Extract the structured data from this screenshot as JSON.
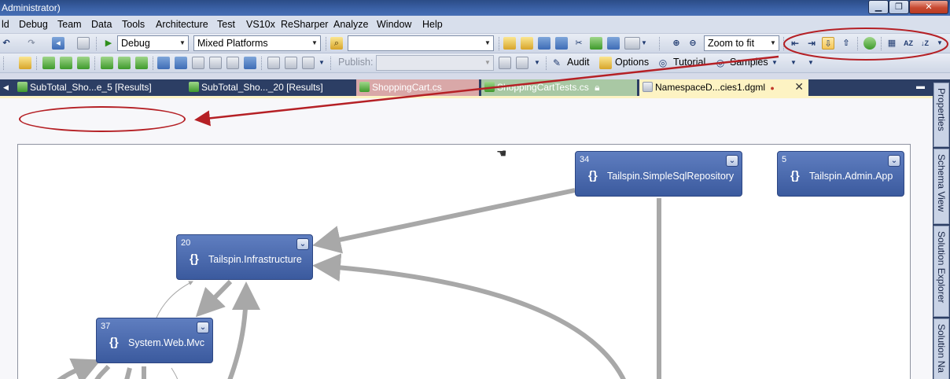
{
  "window": {
    "title_fragment": "Administrator)",
    "minimize_icon": "minimize-icon",
    "maximize_icon": "maximize-icon",
    "close_icon": "close-icon",
    "minimize_glyph": "▁",
    "maximize_glyph": "❐",
    "close_glyph": "✕"
  },
  "menu": [
    "ld",
    "Debug",
    "Team",
    "Data",
    "Tools",
    "Architecture",
    "Test",
    "VS10x",
    "ReSharper",
    "Analyze",
    "Window",
    "Help"
  ],
  "toolbar1": {
    "configuration": "Debug",
    "platform": "Mixed Platforms",
    "find_value": "",
    "zoom_value": "Zoom to fit"
  },
  "toolbar2": {
    "publish_label": "Publish:",
    "publish_value": "",
    "audit_label": "Audit",
    "options_label": "Options",
    "tutorial_label": "Tutorial",
    "samples_label": "Samples"
  },
  "tabs": [
    {
      "label": "SubTotal_Sho...e_5 [Results]",
      "style": "dark"
    },
    {
      "label": "SubTotal_Sho..._20 [Results]",
      "style": "dark"
    },
    {
      "label": "ShoppingCart.cs",
      "style": "cs"
    },
    {
      "label": "ShoppingCartTests.cs",
      "style": "csb"
    },
    {
      "label": "NamespaceD...cies1.dgml",
      "style": "active"
    }
  ],
  "active_tab_modified_mark": "●",
  "side_tabs": [
    "Properties",
    "Schema View",
    "Solution Explorer",
    "Solution Na"
  ],
  "graph": {
    "nodes": [
      {
        "id": "simplesql",
        "count": "34",
        "label": "Tailspin.SimpleSqlRepository"
      },
      {
        "id": "adminapp",
        "count": "5",
        "label": "Tailspin.Admin.App"
      },
      {
        "id": "infrastructure",
        "count": "20",
        "label": "Tailspin.Infrastructure"
      },
      {
        "id": "mvc",
        "count": "37",
        "label": "System.Web.Mvc"
      }
    ]
  },
  "colors": {
    "node_fill": "#4a6aae",
    "edge": "#a8a8a8",
    "annotation": "#b52025",
    "active_tab": "#fdf3c3",
    "title_bar": "#3c63a8"
  }
}
